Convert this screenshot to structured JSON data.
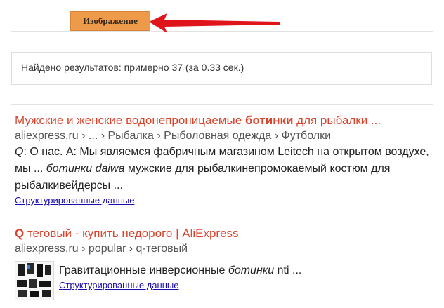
{
  "tabs": {
    "image_label": "Изображение"
  },
  "stats": {
    "text": "Найдено результатов: примерно 37 (за 0.33 сек.)"
  },
  "results": [
    {
      "title_pre": "Мужские и женские водонепроницаемые ",
      "title_bold": "ботинки",
      "title_post": " для рыбалки ...",
      "url": "aliexpress.ru › ... › Рыбалка › Рыболовная одежда › Футболки",
      "snippet_q": "Q",
      "snippet_1": ": О нас. A: Мы являемся фабричным магазином Leitech на открытом воздухе, мы ... ",
      "snippet_em": "ботинки daiwa",
      "snippet_2": " мужские для рыбалкинепромокаемый костюм для рыбалкивейдерсы ...",
      "struct_link": "Структурированные данные"
    },
    {
      "title_bold": "Q",
      "title_post": " теговый - купить недорого | AliExpress",
      "url": "aliexpress.ru › popular › q-теговый",
      "snippet_1": "Гравитационные инверсионные ",
      "snippet_em": "ботинки",
      "snippet_2": " nti ...",
      "struct_link": "Структурированные данные",
      "thumb_icon": "boots-product-thumbnail"
    }
  ],
  "colors": {
    "tab_bg": "#ed9a4a",
    "title_red": "#d8442c",
    "link_blue": "#1a0dab",
    "arrow_red": "#e0141b"
  }
}
